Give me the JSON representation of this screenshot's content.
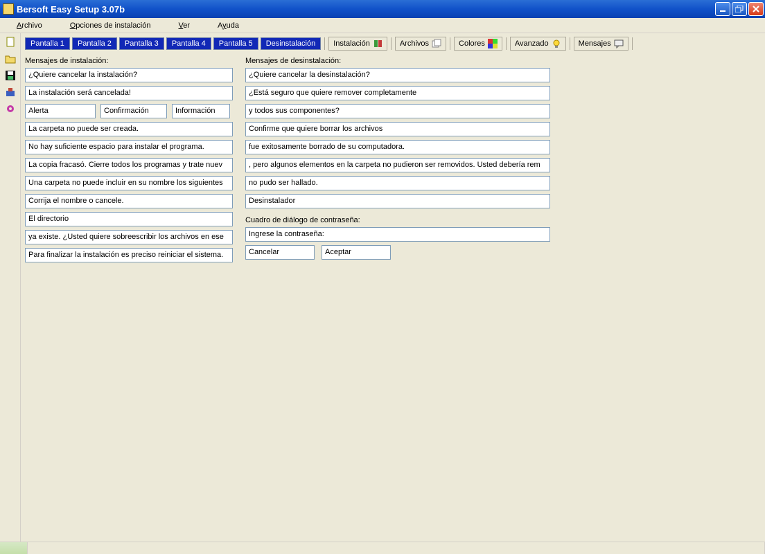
{
  "window": {
    "title": "Bersoft Easy Setup 3.07b"
  },
  "menu": {
    "archivo": "Archivo",
    "opciones": "Opciones de instalación",
    "ver": "Ver",
    "ayuda": "Ayuda"
  },
  "tabs": {
    "pantalla1": "Pantalla 1",
    "pantalla2": "Pantalla 2",
    "pantalla3": "Pantalla 3",
    "pantalla4": "Pantalla 4",
    "pantalla5": "Pantalla 5",
    "desinstalacion": "Desinstalación",
    "instalacion": "Instalación",
    "archivos": "Archivos",
    "colores": "Colores",
    "avanzado": "Avanzado",
    "mensajes": "Mensajes"
  },
  "install": {
    "header": "Mensajes de instalación:",
    "f1": "¿Quiere cancelar la instalación?",
    "f2": "La instalación será cancelada!",
    "f3a": "Alerta",
    "f3b": "Confirmación",
    "f3c": "Información",
    "f4": "La carpeta no puede ser creada.",
    "f5": "No hay suficiente espacio para instalar el programa.",
    "f6": "La copia fracasó. Cierre todos los programas y trate nuev",
    "f7": "Una carpeta no puede incluir en su nombre los siguientes",
    "f8": "Corrija el nombre o cancele.",
    "f9": "El directorio",
    "f10": "ya existe. ¿Usted quiere sobreescribir los archivos en ese",
    "f11": "Para finalizar la instalación es preciso reiniciar el sistema."
  },
  "uninstall": {
    "header": "Mensajes de desinstalación:",
    "f1": "¿Quiere cancelar la desinstalación?",
    "f2": "¿Está seguro que quiere remover completamente",
    "f3": "y todos sus componentes?",
    "f4": "Confirme que quiere borrar los archivos",
    "f5": "fue exitosamente borrado de su computadora.",
    "f6": ", pero algunos elementos en la carpeta no pudieron ser removidos. Usted debería rem",
    "f7": "no pudo ser hallado.",
    "f8": "Desinstalador"
  },
  "password": {
    "header": "Cuadro de diálogo de contraseña:",
    "prompt": "Ingrese la contraseña:",
    "cancel": "Cancelar",
    "ok": "Aceptar"
  }
}
